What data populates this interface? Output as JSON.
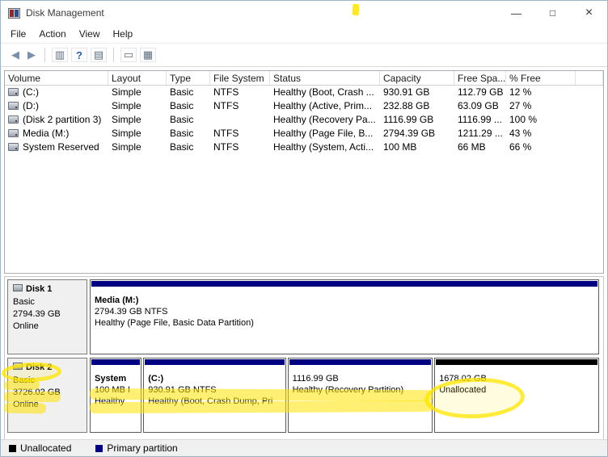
{
  "window": {
    "title": "Disk Management",
    "controls": {
      "minimize": "—",
      "maximize": "□",
      "close": "×"
    }
  },
  "menu": {
    "items": [
      "File",
      "Action",
      "View",
      "Help"
    ]
  },
  "toolbar": {
    "back": "◀",
    "forward": "▶",
    "console_tree": "▥",
    "help": "?",
    "list_view": "▤",
    "comment": "▭",
    "detail_view": "▦"
  },
  "volume_table": {
    "columns": [
      "Volume",
      "Layout",
      "Type",
      "File System",
      "Status",
      "Capacity",
      "Free Spa...",
      "% Free"
    ],
    "rows": [
      {
        "volume": "(C:)",
        "layout": "Simple",
        "type": "Basic",
        "fs": "NTFS",
        "status": "Healthy (Boot, Crash ...",
        "capacity": "930.91 GB",
        "free": "112.79 GB",
        "pct_free": "12 %"
      },
      {
        "volume": "(D:)",
        "layout": "Simple",
        "type": "Basic",
        "fs": "NTFS",
        "status": "Healthy (Active, Prim...",
        "capacity": "232.88 GB",
        "free": "63.09 GB",
        "pct_free": "27 %"
      },
      {
        "volume": "(Disk 2 partition 3)",
        "layout": "Simple",
        "type": "Basic",
        "fs": "",
        "status": "Healthy (Recovery Pa...",
        "capacity": "1116.99 GB",
        "free": "1116.99 ...",
        "pct_free": "100 %"
      },
      {
        "volume": "Media (M:)",
        "layout": "Simple",
        "type": "Basic",
        "fs": "NTFS",
        "status": "Healthy (Page File, B...",
        "capacity": "2794.39 GB",
        "free": "1211.29 ...",
        "pct_free": "43 %"
      },
      {
        "volume": "System Reserved",
        "layout": "Simple",
        "type": "Basic",
        "fs": "NTFS",
        "status": "Healthy (System, Acti...",
        "capacity": "100 MB",
        "free": "66 MB",
        "pct_free": "66 %"
      }
    ]
  },
  "disks": [
    {
      "name": "Disk 1",
      "type": "Basic",
      "size": "2794.39 GB",
      "status": "Online",
      "partitions": [
        {
          "title": "Media  (M:)",
          "line2": "2794.39 GB NTFS",
          "line3": "Healthy (Page File, Basic Data Partition)",
          "kind": "primary"
        }
      ]
    },
    {
      "name": "Disk 2",
      "type": "Basic",
      "size": "3726.02 GB",
      "status": "Online",
      "partitions": [
        {
          "title": "System",
          "line2": "100 MB I",
          "line3": "Healthy",
          "kind": "primary"
        },
        {
          "title": "(C:)",
          "line2": "930.91 GB NTFS",
          "line3": "Healthy (Boot, Crash Dump, Pri",
          "kind": "primary"
        },
        {
          "title": "",
          "line2": "1116.99 GB",
          "line3": "Healthy (Recovery Partition)",
          "kind": "primary"
        },
        {
          "title": "",
          "line2": "1678.02 GB",
          "line3": "Unallocated",
          "kind": "unallocated"
        }
      ]
    }
  ],
  "legend": {
    "unallocated": "Unallocated",
    "primary": "Primary partition"
  },
  "colors": {
    "primary_partition": "#000080",
    "unallocated": "#000000",
    "highlighter": "#FFE400",
    "legend_bg": "#F0F0F0"
  }
}
